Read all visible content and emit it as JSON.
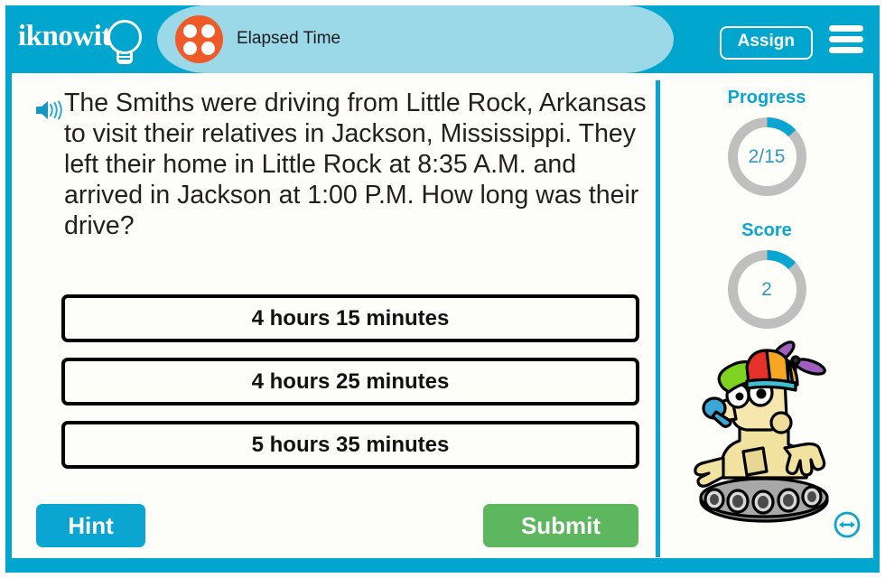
{
  "brand": {
    "logo_text": "iknowit",
    "logo_icon": "lightbulb-icon"
  },
  "header": {
    "topic_title": "Elapsed Time",
    "topic_icon": "four-dot-circle-icon",
    "assign_label": "Assign",
    "menu_icon": "hamburger-menu-icon",
    "bar_color": "#00a6ce",
    "panel_color": "#9bd9e8",
    "topic_icon_color": "#f05a28"
  },
  "question": {
    "speaker_icon": "speaker-audio-icon",
    "text": "The Smiths were driving from Little Rock, Arkansas to visit their relatives in Jackson, Mississippi. They left their home in Little Rock at 8:35 A.M. and arrived in Jackson at 1:00 P.M. How long was their drive?"
  },
  "answers": [
    {
      "label": "4 hours 15 minutes"
    },
    {
      "label": "4 hours 25 minutes"
    },
    {
      "label": "5 hours 35 minutes"
    }
  ],
  "actions": {
    "hint_label": "Hint",
    "hint_color": "#0aa5d0",
    "submit_label": "Submit",
    "submit_color": "#5cb75f"
  },
  "sidebar": {
    "progress": {
      "label": "Progress",
      "value": "2/15",
      "current": 2,
      "total": 15,
      "percent": 13,
      "arc_color": "#0aa5d0",
      "track_color": "#bfbfbf"
    },
    "score": {
      "label": "Score",
      "value": "2",
      "current": 2,
      "percent": 13,
      "arc_color": "#0aa5d0",
      "track_color": "#bfbfbf"
    },
    "mascot_icon": "robot-mascot-propeller-hat",
    "resize_icon": "resize-horizontal-arrow-icon"
  }
}
